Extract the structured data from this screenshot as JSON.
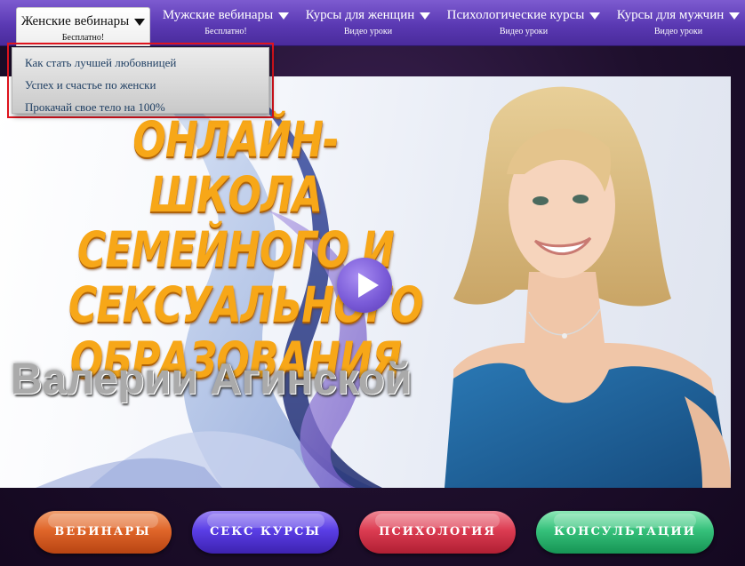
{
  "nav": {
    "items": [
      {
        "label": "Женские вебинары",
        "sub": "Бесплатно!"
      },
      {
        "label": "Мужские вебинары",
        "sub": "Бесплатно!"
      },
      {
        "label": "Курсы для женщин",
        "sub": "Видео уроки"
      },
      {
        "label": "Психологические курсы",
        "sub": "Видео уроки"
      },
      {
        "label": "Курсы для мужчин",
        "sub": "Видео уроки"
      }
    ],
    "dropdown": [
      "Как стать лучшей любовницей",
      "Успех и счастье по женски",
      "Прокачай свое тело на 100%"
    ]
  },
  "hero": {
    "title_lines": [
      "Онлайн-школа",
      "семейного и",
      "сексуального",
      "образования"
    ],
    "name": "Валерии Агинской",
    "play_icon": "play-icon"
  },
  "buttons": [
    {
      "label": "ВЕБИНАРЫ",
      "color": "#e0662a"
    },
    {
      "label": "СЕКС КУРСЫ",
      "color": "#5a3ee6"
    },
    {
      "label": "ПСИХОЛОГИЯ",
      "color": "#dc3c52"
    },
    {
      "label": "КОНСУЛЬТАЦИИ",
      "color": "#36c17b"
    }
  ],
  "colors": {
    "nav": "#5a39b3",
    "dropdown_highlight": "#e0141e",
    "title": "#f7a718",
    "dress": "#1f5e95"
  }
}
